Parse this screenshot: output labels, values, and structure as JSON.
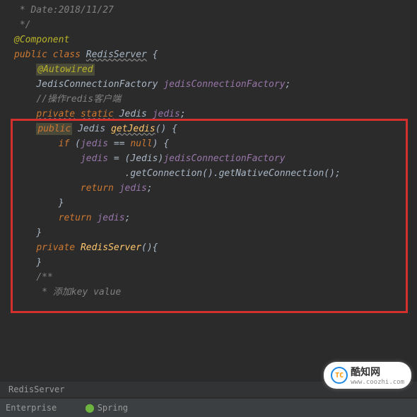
{
  "code": {
    "l1": " * Date:2018/11/27",
    "l2": " */",
    "l3_at": "@",
    "l3_comp": "Component",
    "l4_pub": "public ",
    "l4_cls": "class ",
    "l4_name": "RedisServer",
    "l4_brace": " {",
    "l5": "",
    "l6_pad": "    ",
    "l6_anno": "@Autowired",
    "l7_pad": "    ",
    "l7_type": "JedisConnectionFactory ",
    "l7_var": "jedisConnectionFactory",
    "l7_semi": ";",
    "l8": "",
    "l9_pad": "    ",
    "l9_c": "//操作redis客户端",
    "l10_pad": "    ",
    "l10_priv": "private",
    "l10_sp": " ",
    "l10_stat": "static",
    "l10_type": " Jedis ",
    "l10_var": "jedis",
    "l10_semi": ";",
    "l11": "",
    "l12_pad": "    ",
    "l12_pub": "public",
    "l12_type": " Jedis ",
    "l12_m": "getJedis",
    "l12_paren": "() {",
    "l13_pad": "        ",
    "l13_if": "if ",
    "l13_open": "(",
    "l13_var": "jedis",
    "l13_eq": " == ",
    "l13_null": "null",
    "l13_close": ") {",
    "l14_pad": "            ",
    "l14_var": "jedis",
    "l14_eq": " = (Jedis)",
    "l14_fac": "jedisConnectionFactory",
    "l15_pad": "                    ",
    "l15_m": ".getConnection().getNativeConnection();",
    "l16_pad": "            ",
    "l16_ret": "return ",
    "l16_var": "jedis",
    "l16_semi": ";",
    "l17_pad": "        ",
    "l17_brace": "}",
    "l18_pad": "        ",
    "l18_ret": "return ",
    "l18_var": "jedis",
    "l18_semi": ";",
    "l19_pad": "    ",
    "l19_brace": "}",
    "l20_pad": "    ",
    "l20_priv": "private ",
    "l20_name": "RedisServer",
    "l20_paren": "(){",
    "l21": "",
    "l22_pad": "    ",
    "l22_brace": "}",
    "l23": "",
    "l24_pad": "    ",
    "l24_c": "/**",
    "l25_pad": "     ",
    "l25_c": "* 添加key value"
  },
  "breadcrumb": "RedisServer",
  "status": {
    "enterprise": "Enterprise",
    "spring": "Spring"
  },
  "watermark": {
    "logo": "TC",
    "name": "酷知网",
    "url": "www.coozhi.com"
  }
}
